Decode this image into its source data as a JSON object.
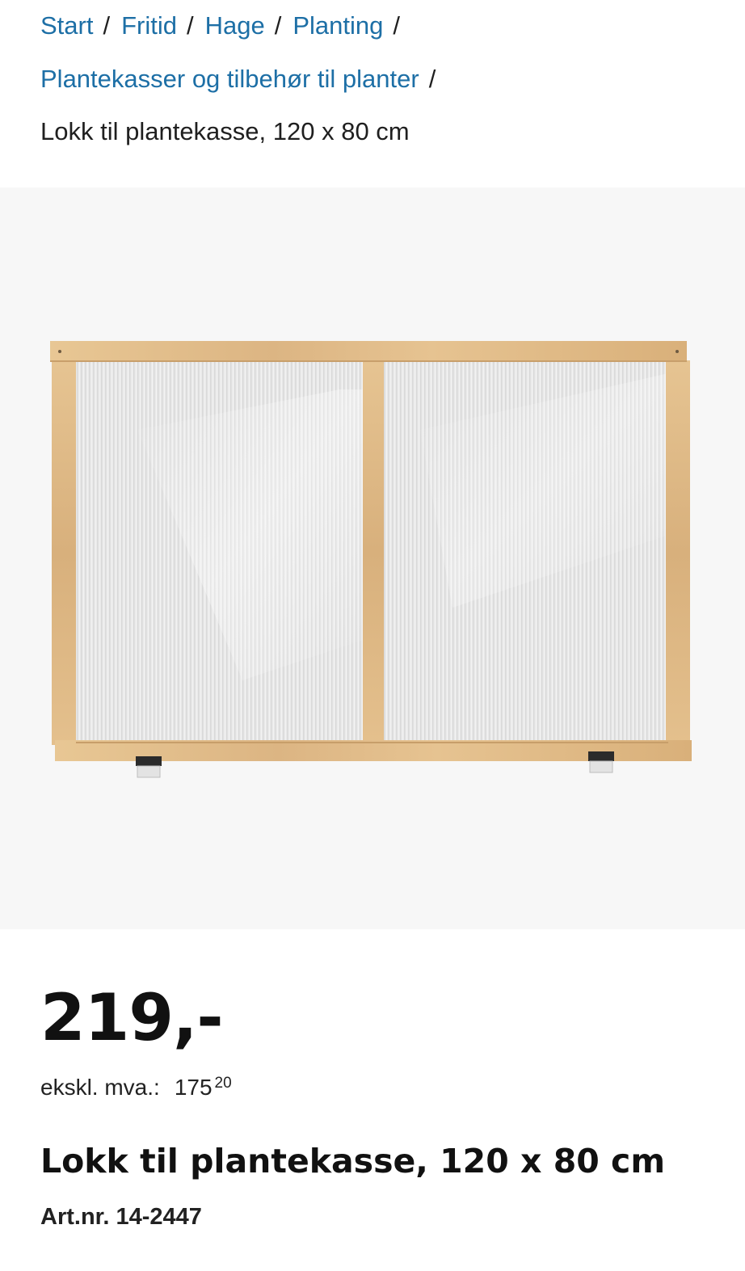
{
  "breadcrumb": {
    "items": [
      {
        "label": "Start"
      },
      {
        "label": "Fritid"
      },
      {
        "label": "Hage"
      },
      {
        "label": "Planting"
      },
      {
        "label": "Plantekasser og tilbehør til planter"
      }
    ],
    "separator": "/",
    "current": "Lokk til plantekasse, 120 x 80 cm"
  },
  "product": {
    "price": "219,-",
    "vat_label": "ekskl. mva.:",
    "vat_amount": "175",
    "vat_cents": "20",
    "title": "Lokk til plantekasse, 120 x 80 cm",
    "article_number": "Art.nr. 14-2447",
    "image_alt": "Lokk til plantekasse, 120 x 80 cm"
  },
  "colors": {
    "link": "#1d6fa6",
    "image_background": "#f7f7f7",
    "wood": "#e2c08f",
    "panel": "#e7e7e7"
  }
}
